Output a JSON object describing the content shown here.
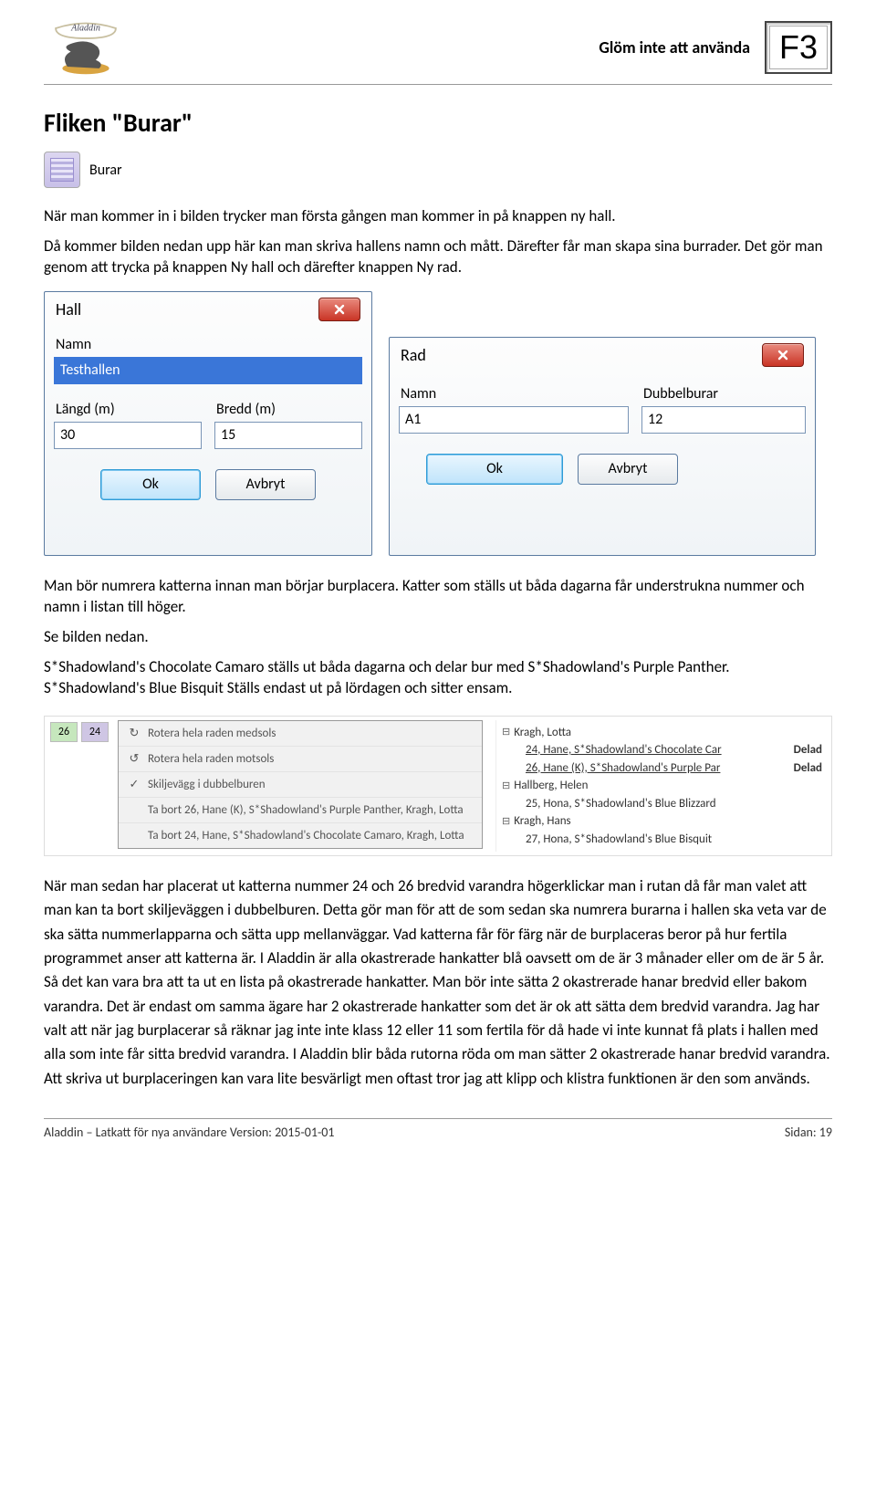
{
  "header": {
    "reminder": "Glöm inte att använda",
    "key": "F3",
    "logo_alt": "Aladdin"
  },
  "title": "Fliken \"Burar\"",
  "tab": {
    "label": "Burar"
  },
  "para1": "När man kommer in i bilden trycker man första gången man kommer in på knappen ny hall.",
  "para2": "Då kommer bilden nedan upp här kan man skriva hallens namn och mått. Därefter får man skapa sina burrader. Det gör man genom att trycka på knappen Ny hall och därefter knappen Ny rad.",
  "dialog_hall": {
    "title": "Hall",
    "name_label": "Namn",
    "name_value": "Testhallen",
    "length_label": "Längd (m)",
    "length_value": "30",
    "width_label": "Bredd (m)",
    "width_value": "15",
    "ok": "Ok",
    "cancel": "Avbryt"
  },
  "dialog_rad": {
    "title": "Rad",
    "name_label": "Namn",
    "name_value": "A1",
    "dub_label": "Dubbelburar",
    "dub_value": "12",
    "ok": "Ok",
    "cancel": "Avbryt"
  },
  "para3": "Man bör numrera katterna innan man börjar burplacera. Katter som ställs ut båda dagarna får understrukna nummer och namn i listan till höger.",
  "para3b": "Se bilden nedan.",
  "para4": "S*Shadowland's Chocolate Camaro ställs ut båda dagarna och delar bur med S*Shadowland's Purple Panther. S*Shadowland's Blue Bisquit Ställs endast ut på lördagen och sitter ensam.",
  "cells": {
    "a": "26",
    "b": "24"
  },
  "ctx": {
    "i1": "Rotera hela raden medsols",
    "i2": "Rotera hela raden motsols",
    "i3": "Skiljevägg i dubbelburen",
    "i4": "Ta bort 26, Hane (K), S*Shadowland's Purple Panther, Kragh, Lotta",
    "i5": "Ta bort 24, Hane, S*Shadowland's Chocolate Camaro, Kragh, Lotta"
  },
  "tree": {
    "o1": "Kragh, Lotta",
    "o1c1": "24, Hane, S*Shadowland's Chocolate Car",
    "o1c1t": "Delad",
    "o1c2": "26, Hane (K), S*Shadowland's Purple Par",
    "o1c2t": "Delad",
    "o2": "Hallberg, Helen",
    "o2c1": "25, Hona, S*Shadowland's Blue Blizzard",
    "o3": "Kragh, Hans",
    "o3c1": "27, Hona, S*Shadowland's Blue Bisquit"
  },
  "para5": "När man sedan har placerat ut katterna nummer 24 och 26 bredvid varandra högerklickar man i rutan då får man valet att man kan ta bort skiljeväggen i dubbelburen. Detta gör man för att de som sedan ska numrera burarna i hallen ska veta var de ska sätta nummerlapparna och sätta upp mellanväggar. Vad katterna får för färg när de burplaceras beror på hur fertila programmet anser att katterna är. I Aladdin är alla okastrerade hankatter blå oavsett om de är 3 månader eller om de är 5 år. Så det kan vara bra att ta ut en lista på okastrerade hankatter. Man bör inte sätta 2 okastrerade hanar bredvid eller bakom varandra. Det är endast om samma ägare har 2 okastrerade hankatter som det är ok att sätta dem bredvid varandra. Jag har valt att när jag burplacerar så räknar jag inte inte klass 12 eller 11 som fertila för då hade vi inte kunnat få plats i hallen med alla som inte får sitta bredvid varandra. I Aladdin blir båda rutorna röda om man sätter 2 okastrerade hanar bredvid varandra.  Att skriva ut burplaceringen kan vara lite besvärligt men oftast tror jag att klipp och klistra funktionen är den som används.",
  "footer": {
    "left": "Aladdin – Latkatt för nya användare Version: 2015-01-01",
    "right": "Sidan: 19"
  }
}
